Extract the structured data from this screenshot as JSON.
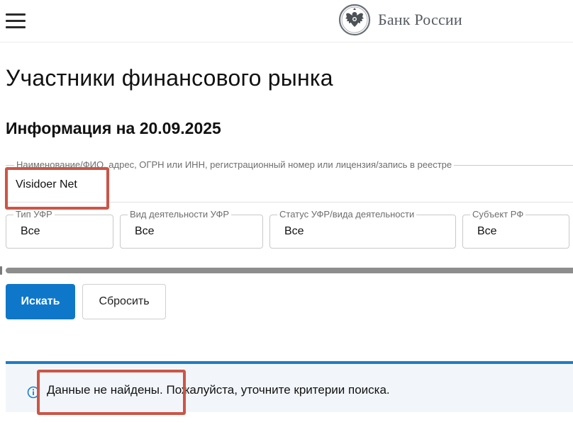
{
  "header": {
    "menu_icon": "hamburger-menu-icon",
    "logo_icon": "double-headed-eagle-emblem-icon",
    "brand_name": "Банк России"
  },
  "page": {
    "title": "Участники финансового рынка",
    "info_date": "Информация на 20.09.2025"
  },
  "search": {
    "label": "Наименование/ФИО, адрес, ОГРН или ИНН, регистрационный номер или лицензия/запись в реестре",
    "value": "Visidoer Net"
  },
  "filters": [
    {
      "label": "Тип УФР",
      "value": "Все"
    },
    {
      "label": "Вид деятельности УФР",
      "value": "Все"
    },
    {
      "label": "Статус УФР/вида деятельности",
      "value": "Все"
    },
    {
      "label": "Субъект РФ",
      "value": "Все"
    }
  ],
  "actions": {
    "search_label": "Искать",
    "reset_label": "Сбросить"
  },
  "notice": {
    "icon": "info-icon",
    "text": "Данные не найдены. Пожалуйста, уточните критерии поиска."
  },
  "colors": {
    "accent": "#0f77c9",
    "info_border": "#1e7cc8",
    "info_background": "#f2f6fa",
    "annotation": "#cc5546"
  }
}
